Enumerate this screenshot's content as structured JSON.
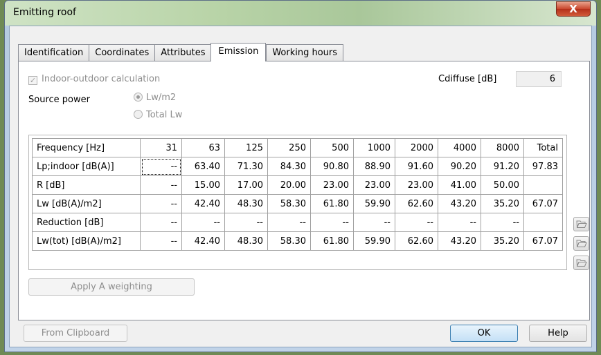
{
  "window": {
    "title": "Emitting roof",
    "close_label": "X"
  },
  "tabs": [
    {
      "label": "Identification",
      "active": false
    },
    {
      "label": "Coordinates",
      "active": false
    },
    {
      "label": "Attributes",
      "active": false
    },
    {
      "label": "Emission",
      "active": true
    },
    {
      "label": "Working hours",
      "active": false
    }
  ],
  "emission": {
    "indoor_outdoor_label": "Indoor-outdoor calculation",
    "indoor_outdoor_checked": true,
    "cdiffuse_label": "Cdiffuse [dB]",
    "cdiffuse_value": "6",
    "source_power_label": "Source power",
    "radio_lw_m2": "Lw/m2",
    "radio_total_lw": "Total Lw",
    "selected_source_power": "Lw/m2"
  },
  "grid": {
    "header": [
      "Frequency [Hz]",
      "31",
      "63",
      "125",
      "250",
      "500",
      "1000",
      "2000",
      "4000",
      "8000",
      "Total"
    ],
    "rows": [
      [
        "Lp;indoor [dB(A)]",
        "--",
        "63.40",
        "71.30",
        "84.30",
        "90.80",
        "88.90",
        "91.60",
        "90.20",
        "91.20",
        "97.83"
      ],
      [
        "R [dB]",
        "--",
        "15.00",
        "17.00",
        "20.00",
        "23.00",
        "23.00",
        "23.00",
        "41.00",
        "50.00",
        ""
      ],
      [
        "Lw [dB(A)/m2]",
        "--",
        "42.40",
        "48.30",
        "58.30",
        "61.80",
        "59.90",
        "62.60",
        "43.20",
        "35.20",
        "67.07"
      ],
      [
        "Reduction [dB]",
        "--",
        "--",
        "--",
        "--",
        "--",
        "--",
        "--",
        "--",
        "--",
        ""
      ],
      [
        "Lw(tot) [dB(A)/m2]",
        "--",
        "42.40",
        "48.30",
        "58.30",
        "61.80",
        "59.90",
        "62.60",
        "43.20",
        "35.20",
        "67.07"
      ]
    ]
  },
  "buttons": {
    "apply_a_weighting": "Apply A weighting",
    "from_clipboard": "From Clipboard",
    "ok": "OK",
    "help": "Help"
  },
  "icons": [
    "folder-open-icon",
    "folder-open-icon",
    "folder-open-icon"
  ]
}
